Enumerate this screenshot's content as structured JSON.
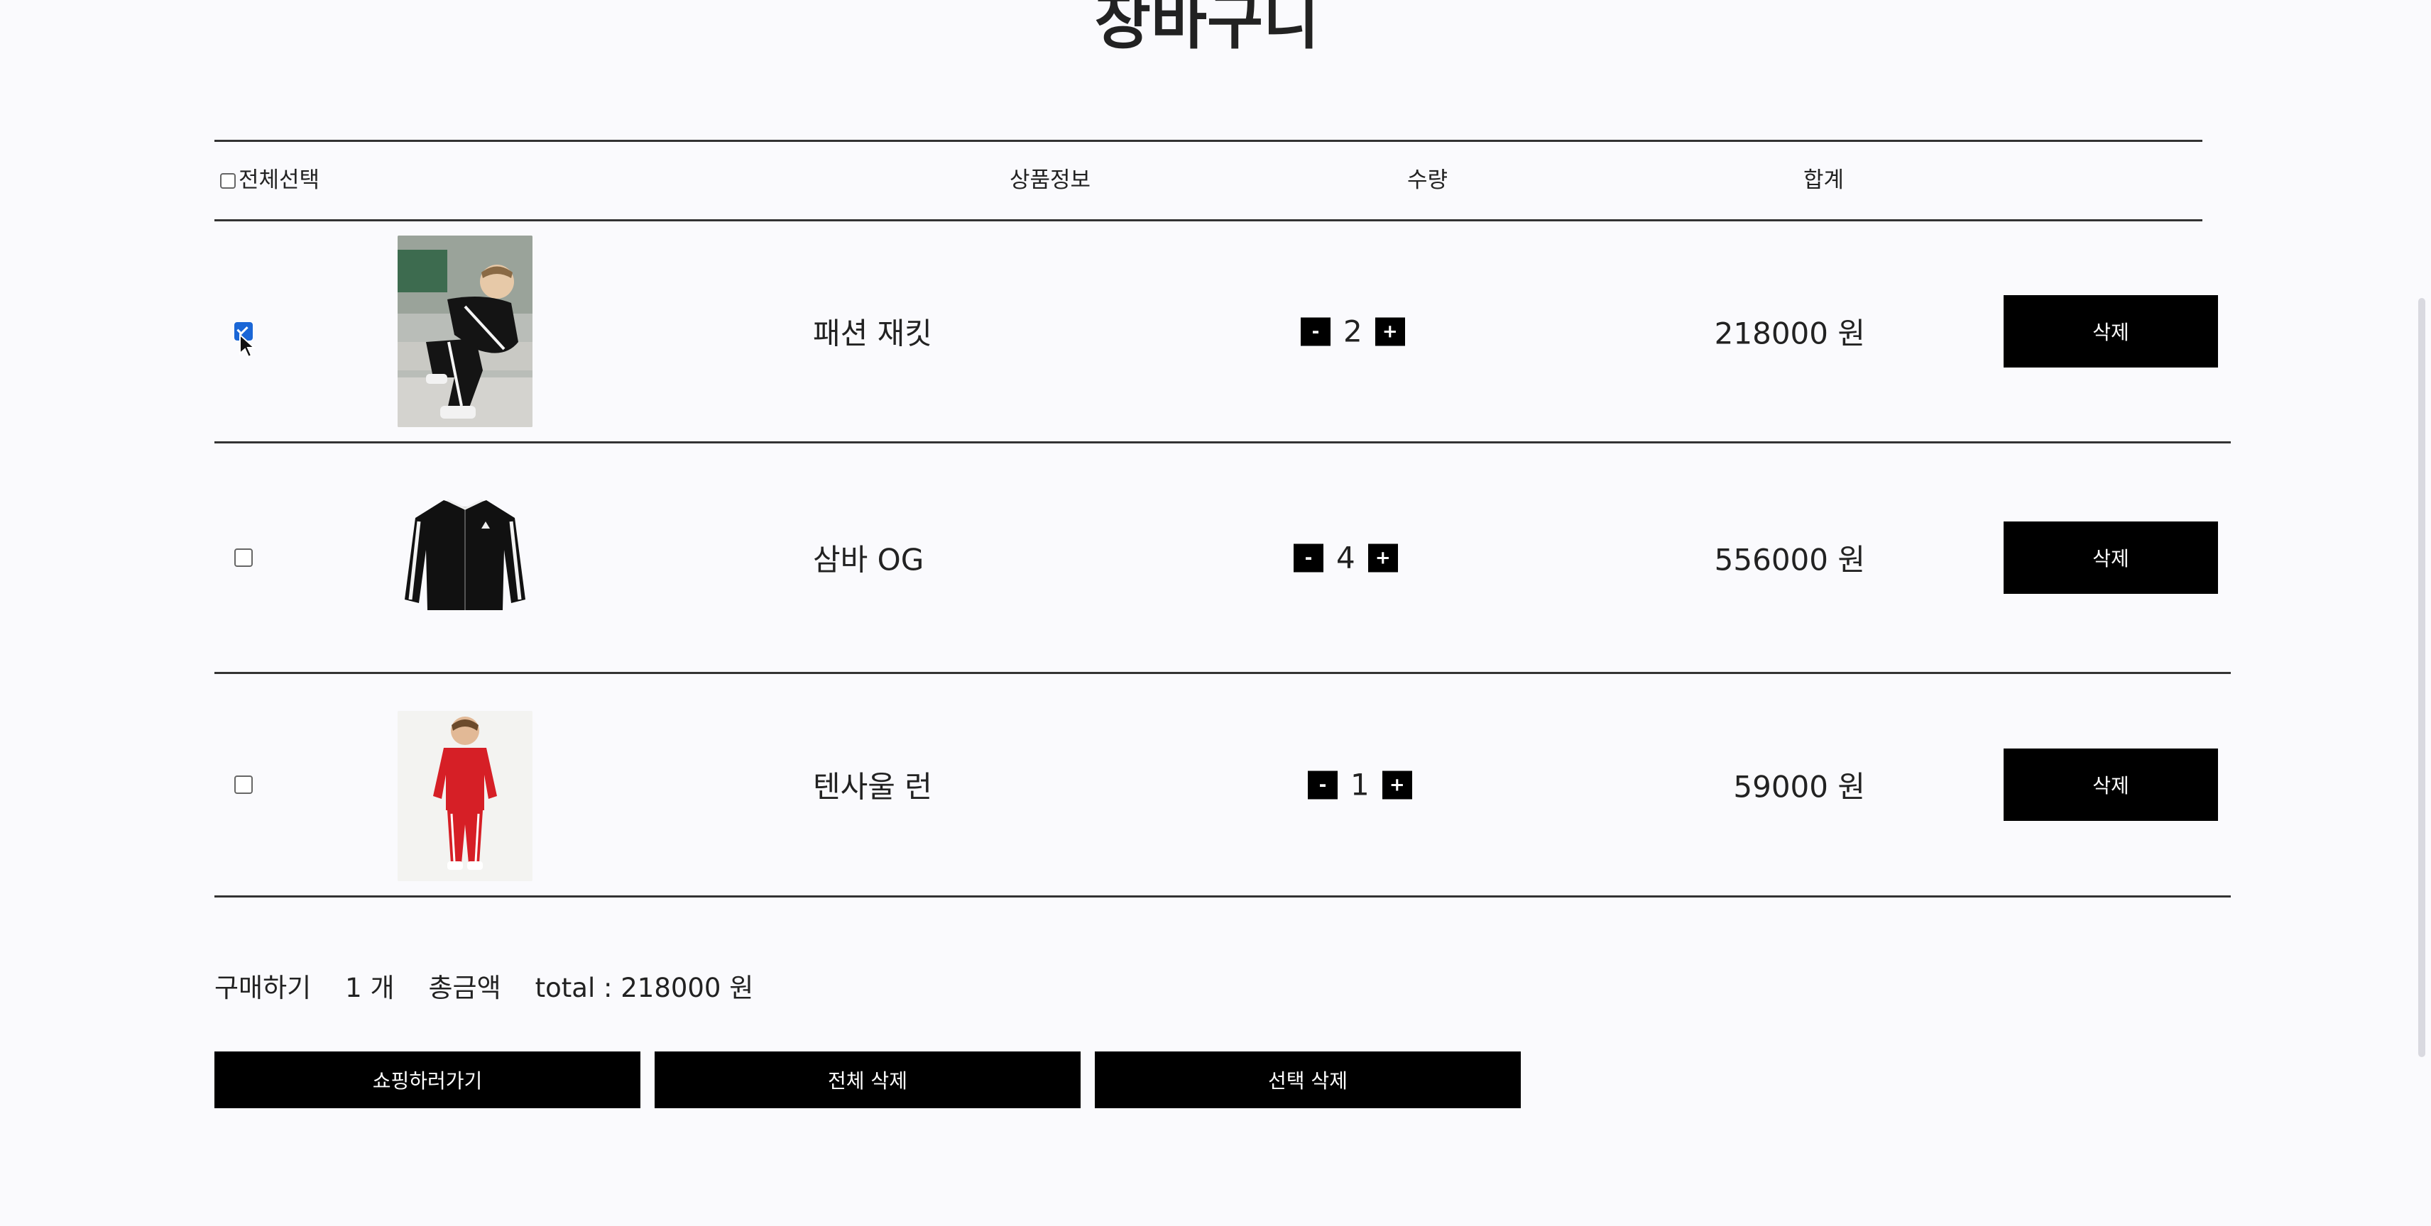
{
  "title": "장바구니",
  "header": {
    "select_all": "전체선택",
    "product_info": "상품정보",
    "quantity": "수량",
    "total": "합계"
  },
  "items": [
    {
      "name": "패션 재킷",
      "qty": "2",
      "total": "218000 원",
      "checked": true,
      "delete_label": "삭제",
      "image": "child-black-tracksuit-photo"
    },
    {
      "name": "삼바 OG",
      "qty": "4",
      "total": "556000 원",
      "checked": false,
      "delete_label": "삭제",
      "image": "black-jacket-photo"
    },
    {
      "name": "텐사울 런",
      "qty": "1",
      "total": "59000 원",
      "checked": false,
      "delete_label": "삭제",
      "image": "child-red-tracksuit-photo"
    }
  ],
  "qty_minus": "-",
  "qty_plus": "+",
  "summary": {
    "buy_label": "구매하기",
    "count": "1 개",
    "total_label": "총금액",
    "total_value": "total : 218000 원"
  },
  "buttons": {
    "go_shopping": "쇼핑하러가기",
    "delete_all": "전체 삭제",
    "delete_selected": "선택 삭제"
  },
  "colors": {
    "background": "#fafafd",
    "button": "#000000",
    "checkbox_checked": "#1a66d6"
  }
}
